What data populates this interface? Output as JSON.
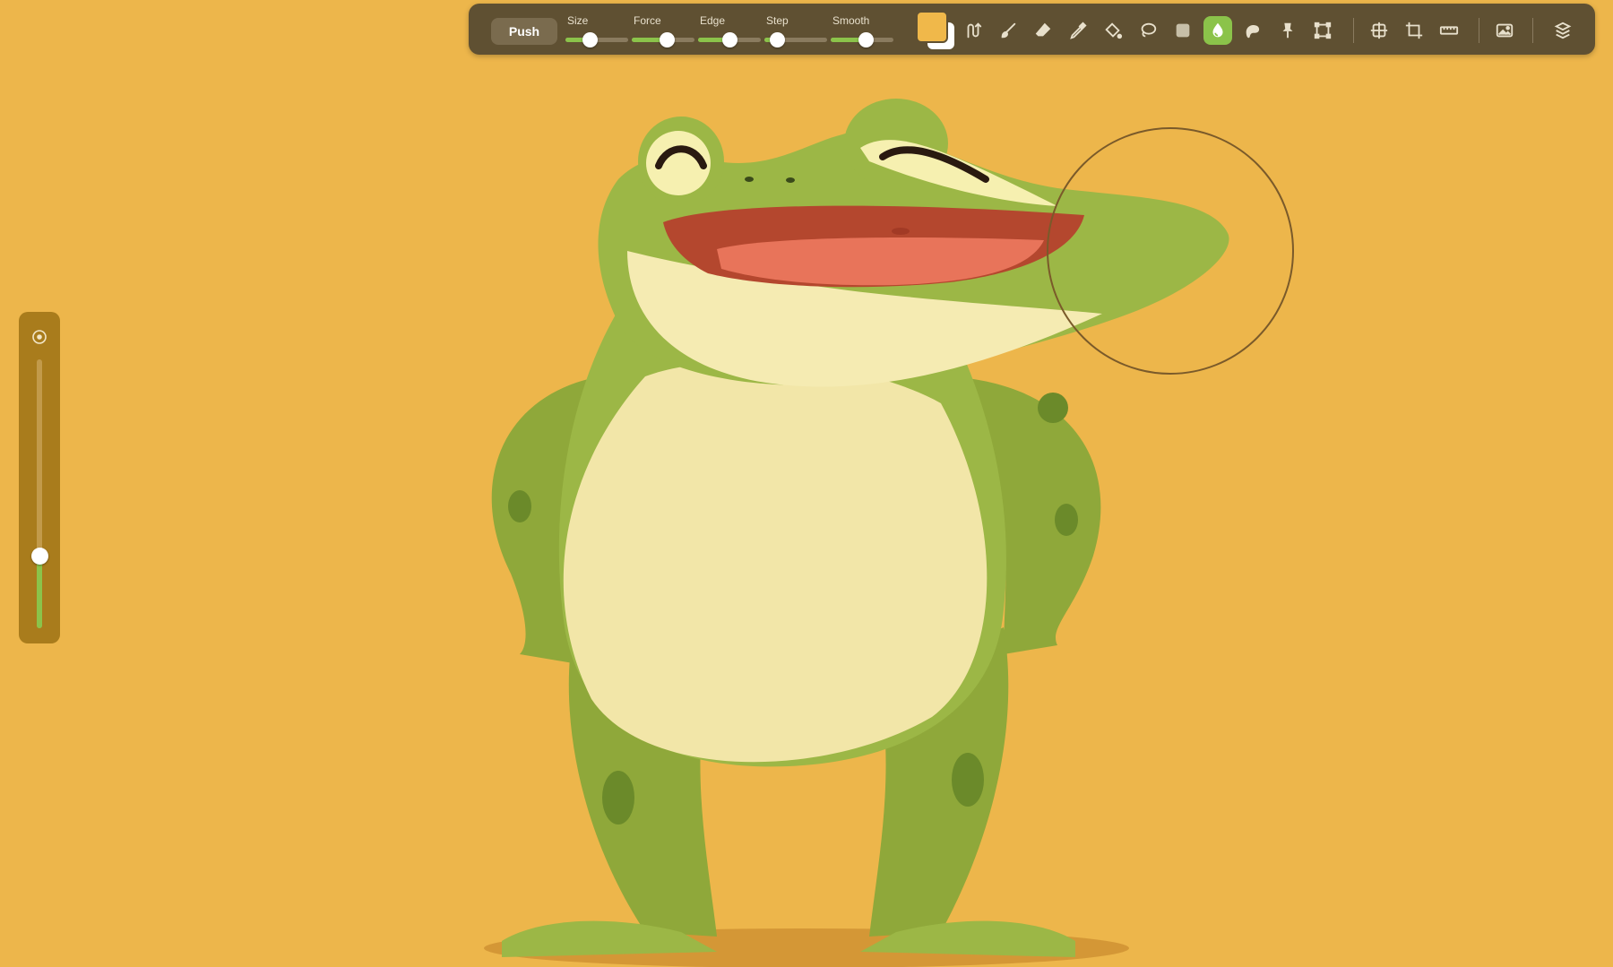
{
  "app": {
    "mode_label": "Push"
  },
  "sliders": [
    {
      "id": "size",
      "label": "Size",
      "value": 0.38
    },
    {
      "id": "force",
      "label": "Force",
      "value": 0.55
    },
    {
      "id": "edge",
      "label": "Edge",
      "value": 0.5
    },
    {
      "id": "step",
      "label": "Step",
      "value": 0.2
    },
    {
      "id": "smooth",
      "label": "Smooth",
      "value": 0.55
    }
  ],
  "colors": {
    "foreground": "#f0b84a",
    "background": "#ffffff",
    "accent": "#8bc34a",
    "toolbar": "#5f5032",
    "canvas_bg": "#edb64b"
  },
  "tools": [
    "stroke-curve-icon",
    "brush-icon",
    "eraser-icon",
    "eyedropper-icon",
    "paint-bucket-icon",
    "lasso-icon",
    "layer-square-icon",
    "liquify-icon",
    "smudge-icon",
    "pin-icon",
    "transform-icon",
    "grid-icon",
    "crop-icon",
    "ruler-icon",
    "image-icon",
    "layers-stack-icon"
  ],
  "active_tool": "liquify-icon",
  "side_slider": {
    "icon": "target-icon",
    "value": 0.27
  }
}
